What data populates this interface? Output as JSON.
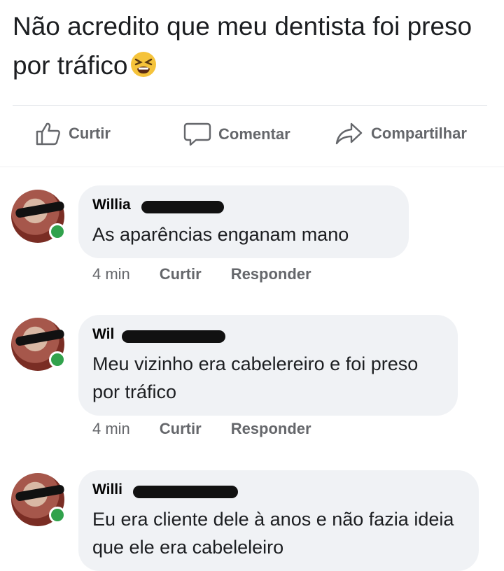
{
  "post": {
    "text": "Não acredito que meu dentista foi preso por tráfico"
  },
  "actions": {
    "like": "Curtir",
    "comment": "Comentar",
    "share": "Compartilhar"
  },
  "comments": [
    {
      "name": "Willia",
      "text": "As aparências enganam mano",
      "time": "4 min",
      "like": "Curtir",
      "reply": "Responder"
    },
    {
      "name": "Wil",
      "text": "Meu vizinho era cabelereiro e foi preso por tráfico",
      "time": "4 min",
      "like": "Curtir",
      "reply": "Responder"
    },
    {
      "name": "Willi",
      "text": "Eu era cliente dele à anos e não fazia ideia que ele era cabeleleiro"
    }
  ],
  "colors": {
    "text": "#1c1e21",
    "secondary": "#65676b",
    "bubble": "#f0f2f5",
    "online": "#31a24c"
  }
}
